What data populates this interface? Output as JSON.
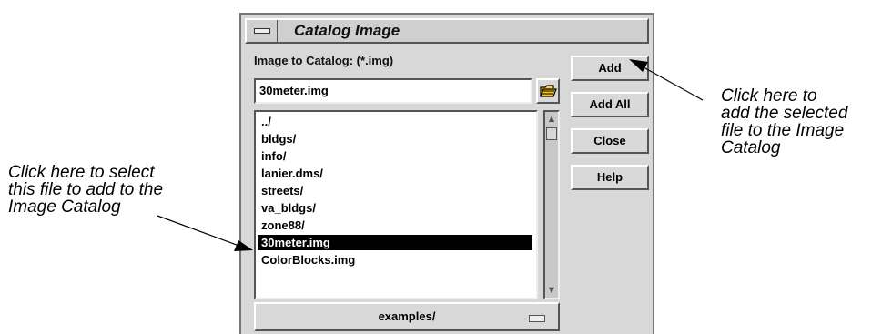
{
  "window": {
    "title": "Catalog Image"
  },
  "form": {
    "label": "Image to Catalog: (*.img)",
    "filename_value": "30meter.img",
    "files": [
      "../",
      "bldgs/",
      "info/",
      "lanier.dms/",
      "streets/",
      "va_bldgs/",
      "zone88/",
      "30meter.img",
      "ColorBlocks.img"
    ],
    "selected_file": "30meter.img",
    "directory": "examples/"
  },
  "buttons": {
    "add": "Add",
    "add_all": "Add All",
    "close": "Close",
    "help": "Help"
  },
  "annotations": {
    "left": "Click here to select\nthis file to add to the\nImage Catalog",
    "right": "Click here to\nadd the selected\nfile to the Image\nCatalog"
  },
  "icons": {
    "menu": "window-menu-icon",
    "folder": "open-folder-icon"
  }
}
